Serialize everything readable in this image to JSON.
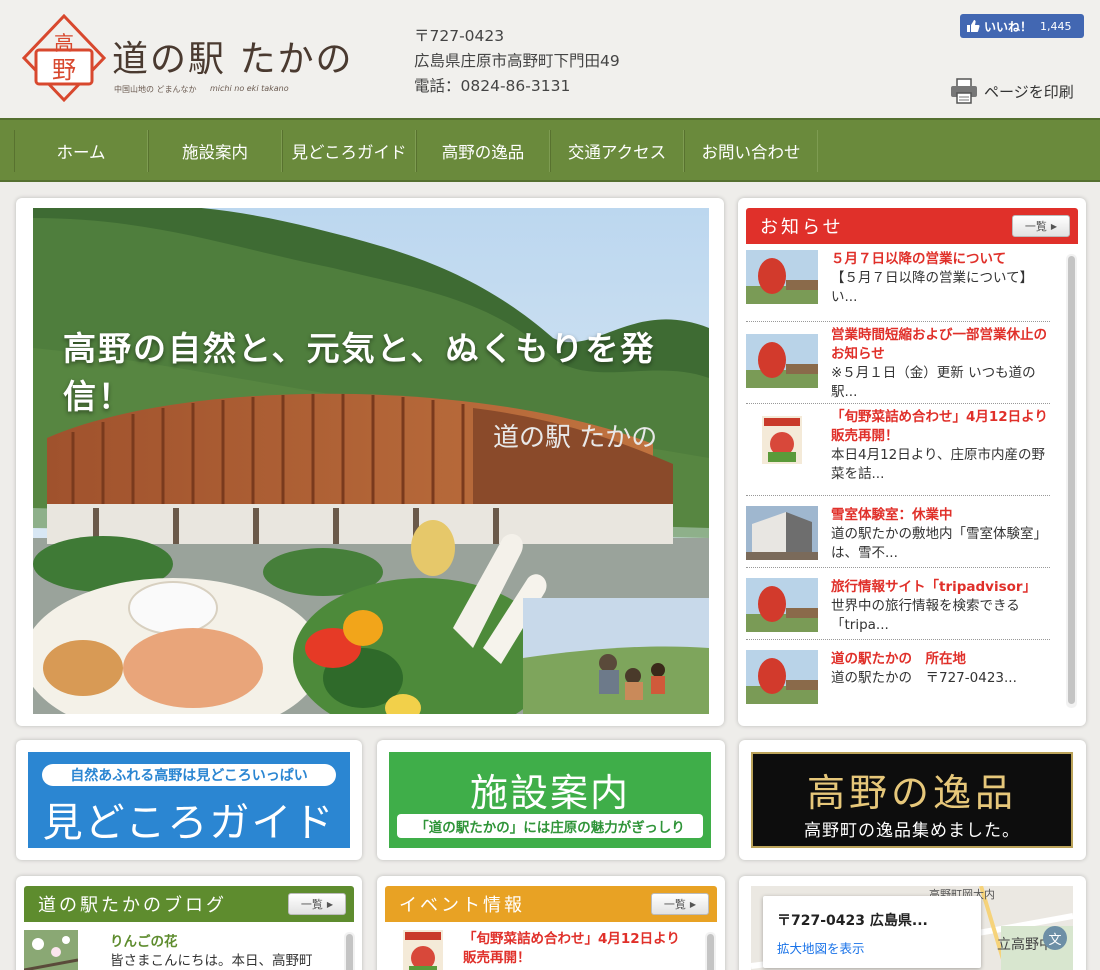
{
  "header": {
    "logo_title": "道の駅 たかの",
    "logo_sub": "中国山地の どまんなか",
    "logo_sub_en": "michi no eki takano",
    "postal": "〒727-0423",
    "address": "広島県庄原市高野町下門田49",
    "phone": "電話：0824-86-3131",
    "fb_like_label": "いいね！",
    "fb_like_count": "1,445",
    "print_label": "ページを印刷",
    "icons": [
      "thumbs-up-icon",
      "printer-icon"
    ]
  },
  "nav": {
    "items": [
      {
        "label": "ホーム"
      },
      {
        "label": "施設案内"
      },
      {
        "label": "見どころガイド"
      },
      {
        "label": "高野の逸品"
      },
      {
        "label": "交通アクセス"
      },
      {
        "label": "お問い合わせ"
      }
    ]
  },
  "hero": {
    "caption": "高野の自然と、元気と、ぬくもりを発信！",
    "sign_text": "道の駅 たかの"
  },
  "news": {
    "heading": "お知らせ",
    "more_label": "一覧",
    "items": [
      {
        "title": "５月７日以降の営業について",
        "body": "【５月７日以降の営業について】い..."
      },
      {
        "title": "営業時間短縮および一部営業休止のお知らせ",
        "body": "※５月１日（金）更新 いつも道の駅..."
      },
      {
        "title": "「旬野菜詰め合わせ」4月12日より販売再開！",
        "body": "本日4月12日より、庄原市内産の野菜を詰..."
      },
      {
        "title": "雪室体験室：休業中",
        "body": "道の駅たかの敷地内「雪室体験室」は、雪不..."
      },
      {
        "title": "旅行情報サイト「tripadvisor」",
        "body": "世界中の旅行情報を検索できる「tripa..."
      },
      {
        "title": "道の駅たかの　所在地",
        "body": "道の駅たかの　〒727-0423..."
      }
    ]
  },
  "banners": {
    "guide": {
      "sub": "自然あふれる高野は見どころいっぱい",
      "main": "見どころガイド"
    },
    "facility": {
      "main": "施設案内",
      "sub": "「道の駅たかの」には庄原の魅力がぎっしり"
    },
    "specialty": {
      "main": "高野の逸品",
      "sub": "高野町の逸品集めました。"
    }
  },
  "blog": {
    "heading": "道の駅たかのブログ",
    "more_label": "一覧",
    "item_title": "りんごの花",
    "item_body": "皆さまこんにちは。本日、高野町"
  },
  "events": {
    "heading": "イベント情報",
    "more_label": "一覧",
    "item_title": "「旬野菜詰め合わせ」4月12日より販売再開！"
  },
  "map": {
    "card_title": "〒727-0423 広島県...",
    "card_link": "拡大地図を表示",
    "label_area": "高野町岡大内",
    "label_school": "立高野中",
    "school_glyph": "文"
  },
  "colors": {
    "nav_green": "#6a8a3c",
    "news_red": "#e0302a",
    "blog_green": "#5e8c2e",
    "event_orange": "#e8a224",
    "guide_blue": "#2b86d2",
    "facility_green": "#3fae49",
    "specialty_gold": "#e6c77a"
  }
}
